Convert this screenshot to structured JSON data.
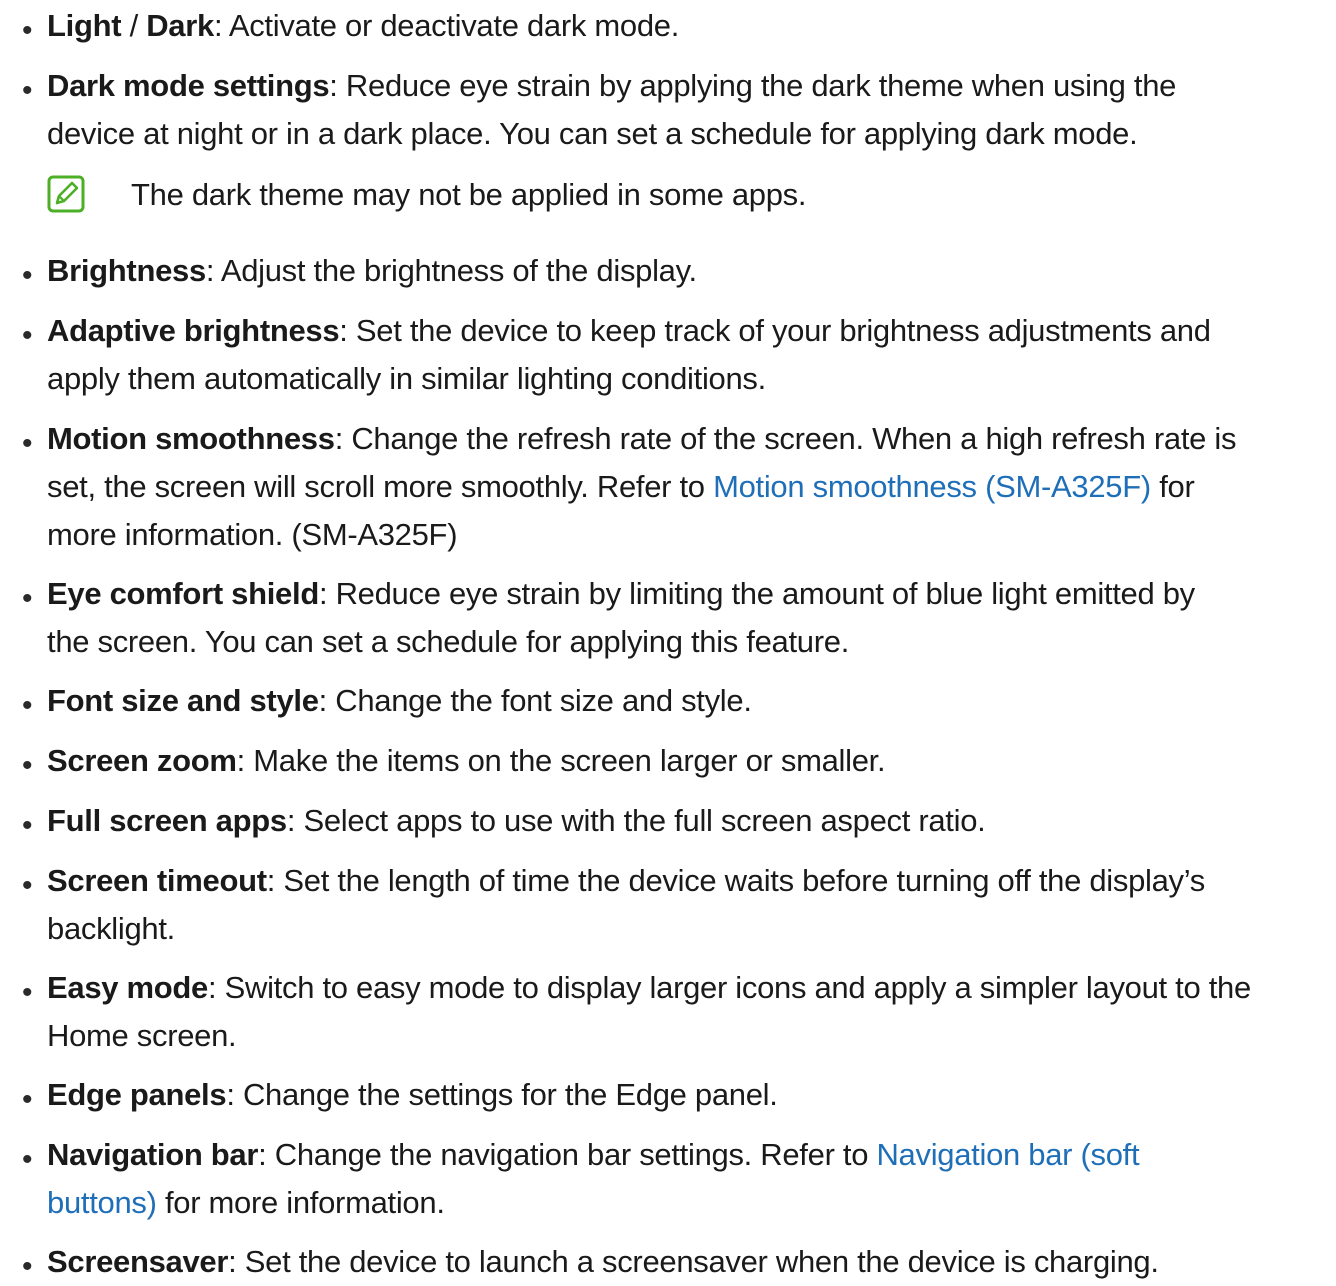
{
  "items": [
    {
      "term": "Light",
      "sep": " / ",
      "term2": "Dark",
      "desc": ": Activate or deactivate dark mode."
    },
    {
      "term": "Dark mode settings",
      "desc_line1": ": Reduce eye strain by applying the dark theme when using the",
      "desc_line2": "device at night or in a dark place. You can set a schedule for applying dark mode."
    },
    {
      "term": "Brightness",
      "desc": ": Adjust the brightness of the display."
    },
    {
      "term": "Adaptive brightness",
      "desc_line1": ": Set the device to keep track of your brightness adjustments and",
      "desc_line2": "apply them automatically in similar lighting conditions."
    },
    {
      "term": "Motion smoothness",
      "desc_line1": ": Change the refresh rate of the screen. When a high refresh rate is",
      "desc_line2a": "set, the screen will scroll more smoothly. Refer to ",
      "link": "Motion smoothness (SM-A325F)",
      "desc_line2b": " for",
      "desc_line3": "more information. (SM-A325F)"
    },
    {
      "term": "Eye comfort shield",
      "desc_line1": ": Reduce eye strain by limiting the amount of blue light emitted by",
      "desc_line2": "the screen. You can set a schedule for applying this feature."
    },
    {
      "term": "Font size and style",
      "desc": ": Change the font size and style."
    },
    {
      "term": "Screen zoom",
      "desc": ": Make the items on the screen larger or smaller."
    },
    {
      "term": "Full screen apps",
      "desc": ": Select apps to use with the full screen aspect ratio."
    },
    {
      "term": "Screen timeout",
      "desc_line1": ": Set the length of time the device waits before turning off the display’s",
      "desc_line2": "backlight."
    },
    {
      "term": "Easy mode",
      "desc_line1": ": Switch to easy mode to display larger icons and apply a simpler layout to the",
      "desc_line2": "Home screen."
    },
    {
      "term": "Edge panels",
      "desc": ": Change the settings for the Edge panel."
    },
    {
      "term": "Navigation bar",
      "desc_line1a": ": Change the navigation bar settings. Refer to ",
      "link_line1": "Navigation bar (soft",
      "link_line2": "buttons)",
      "desc_line2b": " for more information."
    },
    {
      "term": "Screensaver",
      "desc": ": Set the device to launch a screensaver when the device is charging."
    }
  ],
  "note": {
    "icon": "note-pencil-icon",
    "text": "The dark theme may not be applied in some apps.",
    "icon_color": "#4caf25"
  },
  "bullet": "•",
  "link_color": "#1f6fb8"
}
